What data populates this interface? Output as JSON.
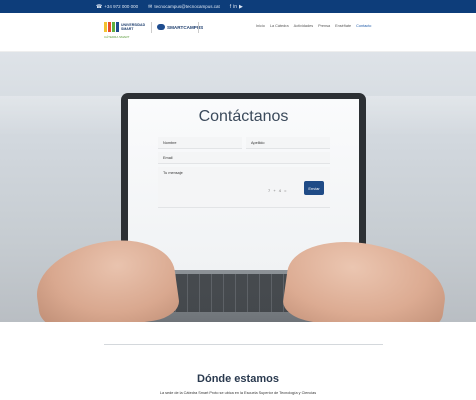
{
  "topbar": {
    "phone": "+34 972 000 000",
    "email": "tecnocampus@tecnocampus.cat",
    "social": [
      "f-icon",
      "in-icon",
      "yt-icon"
    ]
  },
  "logo": {
    "university_line1": "UNIVERSIDAD",
    "university_line2": "SMART",
    "subtitle": "CÁTEDRA SMART",
    "partner": "SMARTCAMPUS"
  },
  "nav": {
    "items": [
      "Inicio",
      "La Cátedra",
      "Actividades",
      "Prensa",
      "Enséñate",
      "Contacto"
    ]
  },
  "form": {
    "title": "Contáctanos",
    "name_label": "Nombre",
    "surname_label": "Apellido",
    "email_label": "Email",
    "message_label": "Tu mensaje",
    "captcha": "7 + 4 =",
    "send_label": "Enviar"
  },
  "location": {
    "heading": "Dónde estamos",
    "text": "La sede de la Cátedra Smart Proto se ubica en la Escuela Superior de Tecnología y Ciencias"
  },
  "colors": {
    "topbar": "#0d3d7a",
    "accent": "#1f4b86",
    "logo_bars": [
      "#f2c230",
      "#e94e2a",
      "#5fb040",
      "#1e4c8f"
    ]
  }
}
